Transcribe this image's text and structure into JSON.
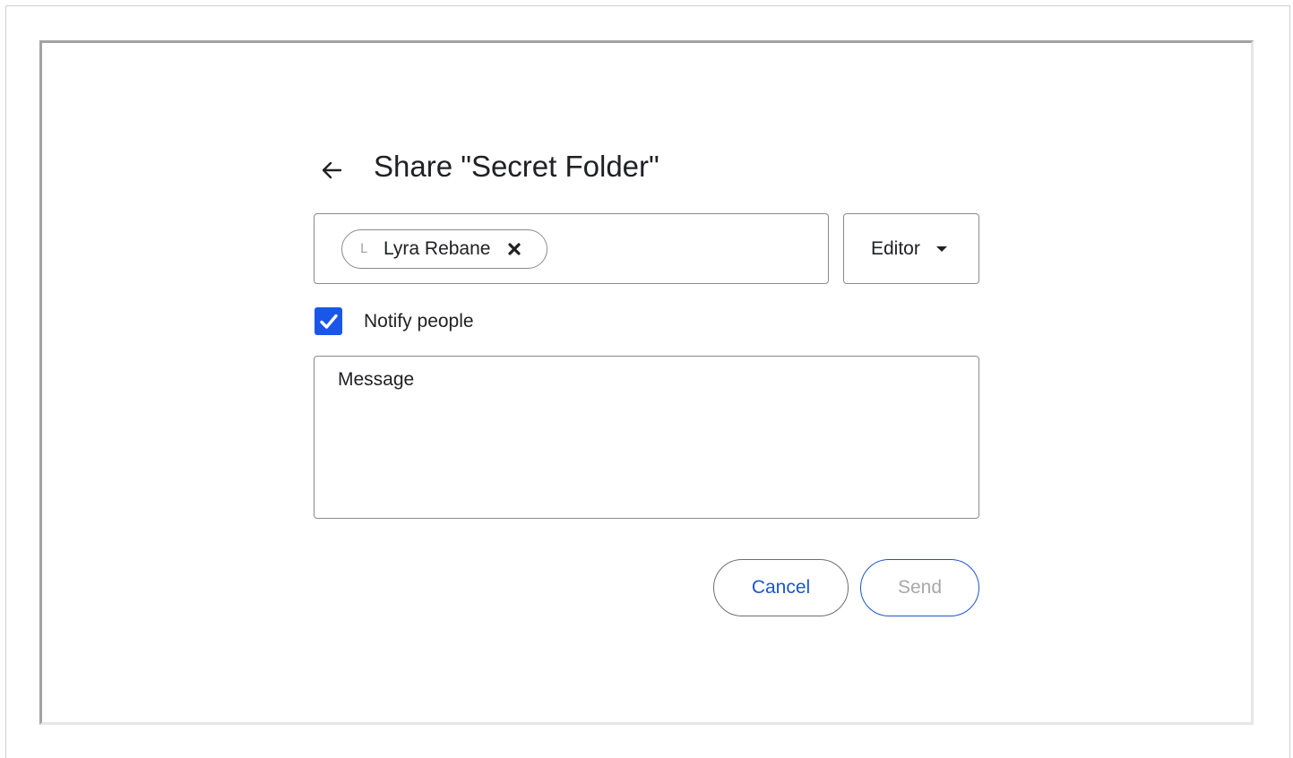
{
  "dialog": {
    "title": "Share \"Secret Folder\"",
    "back_icon": "arrow-left-icon"
  },
  "recipients": {
    "chips": [
      {
        "avatar_glyph": "L",
        "name": "Lyra Rebane",
        "remove_icon": "close-x-icon"
      }
    ]
  },
  "role": {
    "selected": "Editor",
    "caret_icon": "caret-down-icon"
  },
  "notify": {
    "checked": true,
    "label": "Notify people",
    "color": "#1a57e8"
  },
  "message": {
    "placeholder": "Message",
    "value": ""
  },
  "actions": {
    "cancel_label": "Cancel",
    "send_label": "Send",
    "accent_color": "#1a57c8"
  }
}
